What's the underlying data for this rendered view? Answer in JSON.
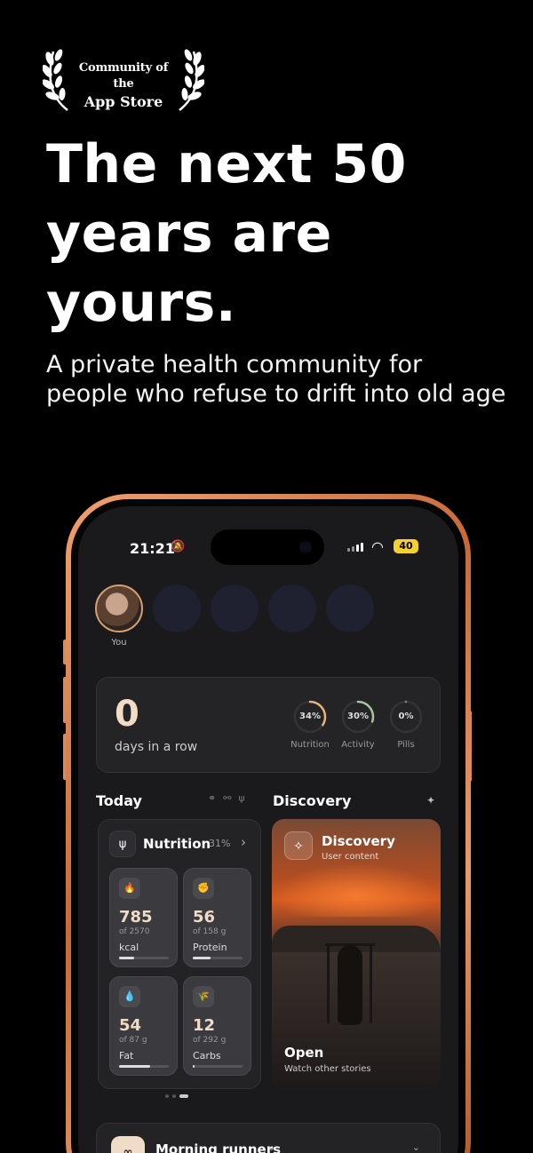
{
  "badge": {
    "line1": "Community of the",
    "line2": "App Store"
  },
  "headline": "The next 50 years are yours.",
  "subhead": "A private health community for people who refuse to drift into old age",
  "status": {
    "time": "21:21",
    "bell_icon": "bell-off-icon",
    "battery": "40"
  },
  "stories": {
    "you_label": "You"
  },
  "streak": {
    "count": "0",
    "label": "days in a row",
    "rings": [
      {
        "pct": "34%",
        "label": "Nutrition",
        "value": 0.34,
        "color": "#e8b27a"
      },
      {
        "pct": "30%",
        "label": "Activity",
        "value": 0.3,
        "color": "#a8c4a0"
      },
      {
        "pct": "0%",
        "label": "Pills",
        "value": 0.0,
        "color": "#888888"
      }
    ]
  },
  "today": {
    "title": "Today"
  },
  "discovery_header": {
    "title": "Discovery"
  },
  "nutrition": {
    "title": "Nutrition",
    "pct": "31%",
    "tiles": [
      {
        "icon": "flame-icon",
        "glyph": "🔥",
        "value": "785",
        "of": "of 2570",
        "name": "kcal",
        "progress": 0.31
      },
      {
        "icon": "muscle-icon",
        "glyph": "✊",
        "value": "56",
        "of": "of 158 g",
        "name": "Protein",
        "progress": 0.35
      },
      {
        "icon": "drop-icon",
        "glyph": "💧",
        "value": "54",
        "of": "of 87 g",
        "name": "Fat",
        "progress": 0.62
      },
      {
        "icon": "grain-icon",
        "glyph": "🌾",
        "value": "12",
        "of": "of 292 g",
        "name": "Carbs",
        "progress": 0.04
      }
    ]
  },
  "discovery": {
    "title": "Discovery",
    "subtitle": "User content",
    "open": "Open",
    "watch": "Watch other stories"
  },
  "group": {
    "title": "Morning runners"
  }
}
